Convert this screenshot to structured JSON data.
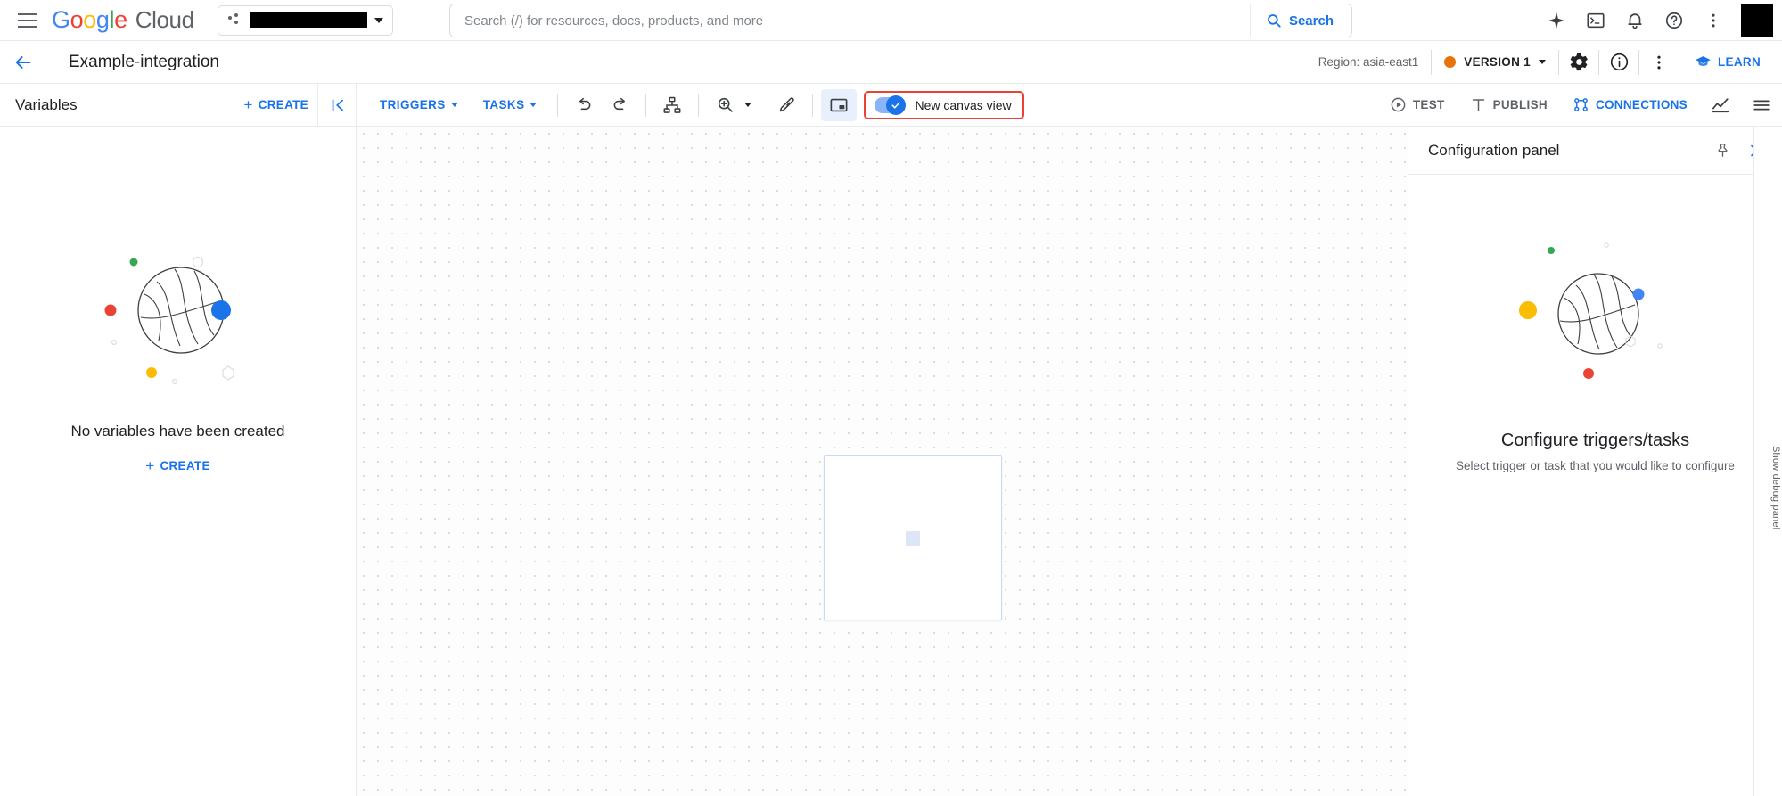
{
  "topbar": {
    "menu_icon": "hamburger-icon",
    "logo": {
      "g1": "G",
      "o1": "o",
      "o2": "o",
      "g2": "g",
      "l": "l",
      "e": "e",
      "cloud": "Cloud"
    },
    "project_selector": {
      "icon": "project-icon",
      "value_redacted": true,
      "caret": "chevron-down-icon"
    },
    "search": {
      "placeholder": "Search (/) for resources, docs, products, and more",
      "value": "",
      "button_label": "Search",
      "icon": "search-icon"
    },
    "icons": [
      {
        "name": "gemini-sparkle-icon",
        "label": "Gemini"
      },
      {
        "name": "cloud-shell-icon",
        "label": "Activate Cloud Shell"
      },
      {
        "name": "notifications-bell-icon",
        "label": "Notifications"
      },
      {
        "name": "help-question-icon",
        "label": "Support"
      },
      {
        "name": "more-vert-icon",
        "label": "More options"
      }
    ],
    "avatar_redacted": true
  },
  "subheader": {
    "back_icon": "arrow-back-icon",
    "title": "Example-integration",
    "region": "Region: asia-east1",
    "version": {
      "label": "VERSION 1",
      "status_color": "#e8710a",
      "caret": "chevron-down-icon"
    },
    "settings_icon": "gear-icon",
    "info_icon": "info-icon",
    "more_icon": "more-vert-icon",
    "learn": {
      "label": "LEARN",
      "icon": "school-icon"
    }
  },
  "variables_panel": {
    "title": "Variables",
    "create_label": "CREATE",
    "create_icon": "plus-icon",
    "collapse_icon": "collapse-left-icon",
    "empty_message": "No variables have been created",
    "empty_create_label": "CREATE"
  },
  "canvas_toolbar": {
    "triggers": {
      "label": "TRIGGERS",
      "caret": "chevron-down-icon"
    },
    "tasks": {
      "label": "TASKS",
      "caret": "chevron-down-icon"
    },
    "undo_icon": "undo-icon",
    "redo_icon": "redo-icon",
    "layout_icon": "auto-layout-icon",
    "zoom_icon": "zoom-in-icon",
    "zoom_caret": "chevron-down-icon",
    "pen_icon": "edit-path-icon",
    "minimap_icon": "minimap-icon",
    "new_canvas_toggle": {
      "label": "New canvas view",
      "checked": true,
      "highlight_color": "#ea4335"
    },
    "test": {
      "label": "TEST",
      "icon": "play-circle-icon"
    },
    "publish": {
      "label": "PUBLISH",
      "icon": "publish-icon"
    },
    "connections": {
      "label": "CONNECTIONS",
      "icon": "connections-icon"
    },
    "analytics_icon": "analytics-icon",
    "list_icon": "list-menu-icon"
  },
  "configuration_panel": {
    "title": "Configuration panel",
    "pin_icon": "pin-icon",
    "expand_icon": "expand-right-icon",
    "empty_title": "Configure triggers/tasks",
    "empty_subtitle": "Select trigger or task that you would like to configure"
  },
  "debug_rail": {
    "label": "Show debug panel"
  }
}
